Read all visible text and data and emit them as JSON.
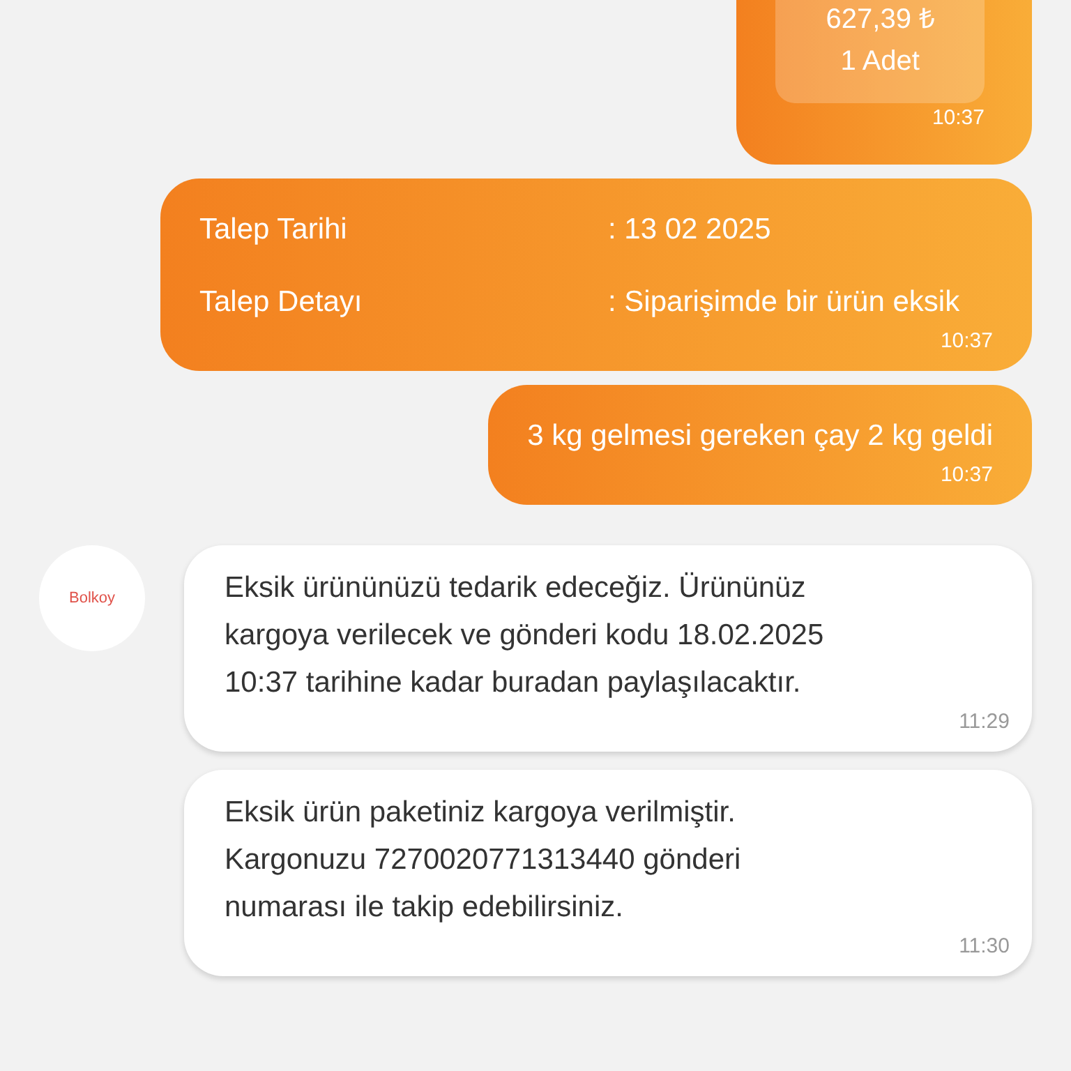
{
  "messages": [
    {
      "kind": "product",
      "sent": true,
      "price": "627,39 ₺",
      "quantity": "1 Adet",
      "time": "10:37"
    },
    {
      "kind": "form",
      "sent": true,
      "fields": [
        {
          "label": "Talep Tarihi",
          "value": ": 13 02 2025"
        },
        {
          "label": "Talep Detayı",
          "value": ": Siparişimde bir ürün eksik"
        }
      ],
      "time": "10:37"
    },
    {
      "kind": "text",
      "sent": true,
      "text": "3 kg gelmesi gereken çay 2 kg geldi",
      "time": "10:37"
    },
    {
      "kind": "text",
      "sent": false,
      "avatar": "Bolkoy",
      "text": "Eksik ürününüzü tedarik edeceğiz. Ürününüz kargoya verilecek ve gönderi kodu 18.02.2025 10:37 tarihine kadar buradan paylaşılacaktır.",
      "time": "11:29"
    },
    {
      "kind": "text",
      "sent": false,
      "text": "Eksik ürün paketiniz kargoya verilmiştir. Kargonuzu 7270020771313440 gönderi numarası ile takip edebilirsiniz.",
      "time": "11:30"
    }
  ]
}
